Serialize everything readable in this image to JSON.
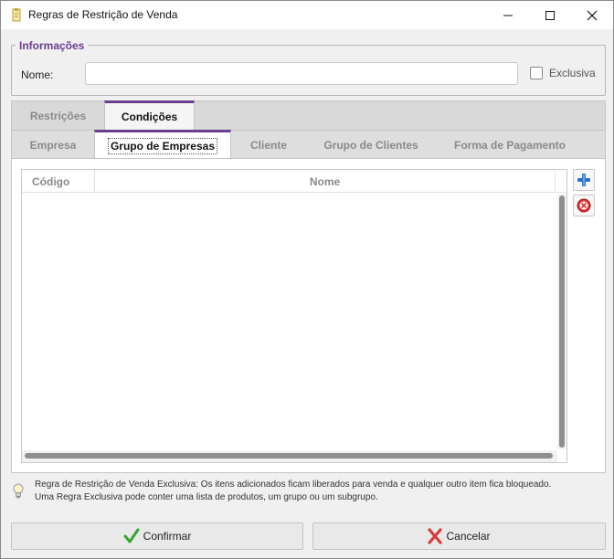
{
  "window": {
    "title": "Regras de Restrição de Venda"
  },
  "informacoes": {
    "group_title": "Informações",
    "nome_label": "Nome:",
    "nome_value": "",
    "exclusiva_label": "Exclusiva",
    "exclusiva_checked": false
  },
  "main_tabs": [
    {
      "label": "Restrições",
      "active": false
    },
    {
      "label": "Condições",
      "active": true
    }
  ],
  "sub_tabs": [
    {
      "label": "Empresa",
      "active": false
    },
    {
      "label": "Grupo de Empresas",
      "active": true
    },
    {
      "label": "Cliente",
      "active": false
    },
    {
      "label": "Grupo de Clientes",
      "active": false
    },
    {
      "label": "Forma de Pagamento",
      "active": false
    }
  ],
  "grid": {
    "columns": [
      "Código",
      "Nome"
    ],
    "rows": []
  },
  "side_buttons": {
    "add_icon": "plus-icon",
    "remove_icon": "remove-circle-icon"
  },
  "hint": {
    "icon": "lightbulb-icon",
    "line1": "Regra de Restrição de Venda Exclusiva: Os itens adicionados ficam liberados para venda e qualquer outro item fica bloqueado.",
    "line2": "Uma Regra Exclusiva pode conter uma lista de produtos, um grupo ou um subgrupo."
  },
  "footer": {
    "confirm_label": "Confirmar",
    "cancel_label": "Cancelar"
  },
  "colors": {
    "accent": "#6a3d8f",
    "confirm_icon": "#3aa335",
    "cancel_icon": "#d83a3a"
  }
}
